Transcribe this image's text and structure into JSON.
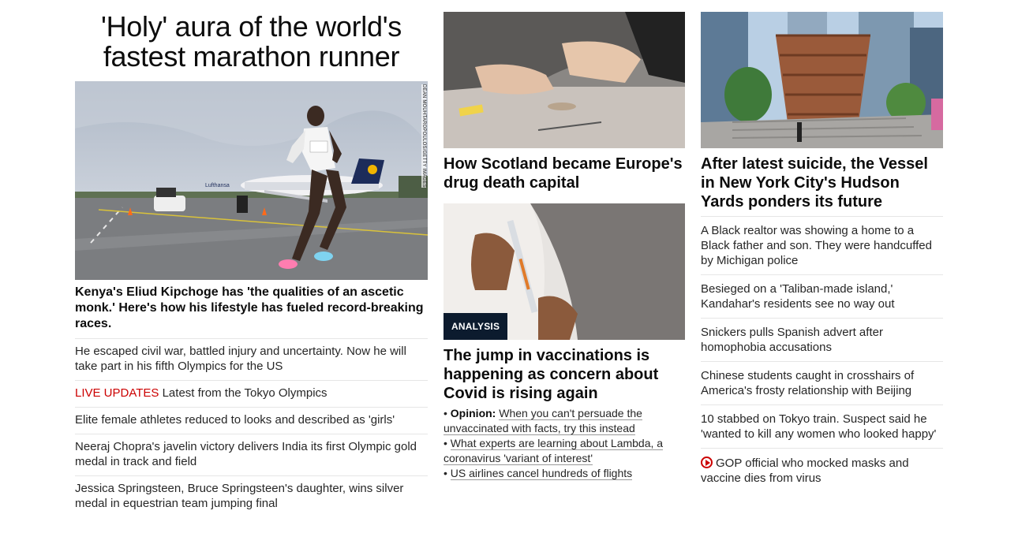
{
  "col1": {
    "title": "'Holy' aura of the world's fastest marathon runner",
    "image_credit": "DEAN MOUHTAROPOULOS/GETTY IMAGES",
    "caption": "Kenya's Eliud Kipchoge has 'the qualities of an ascetic monk.' Here's how his lifestyle has fueled record-breaking races.",
    "items": [
      {
        "text": "He escaped civil war, battled injury and uncertainty. Now he will take part in his fifth Olympics for the US"
      },
      {
        "live": "LIVE UPDATES",
        "text": " Latest from the Tokyo Olympics"
      },
      {
        "text": "Elite female athletes reduced to looks and described as 'girls'"
      },
      {
        "text": "Neeraj Chopra's javelin victory delivers India its first Olympic gold medal in track and field"
      },
      {
        "text": "Jessica Springsteen, Bruce Springsteen's daughter, wins silver medal in equestrian team jumping final"
      }
    ]
  },
  "col2": {
    "story1": {
      "headline": "How Scotland became Europe's drug death capital"
    },
    "story2": {
      "badge": "ANALYSIS",
      "headline": "The jump in vaccinations is happening as concern about Covid is rising again",
      "bullets": [
        {
          "prefix": "Opinion:",
          "text": "When you can't persuade the unvaccinated with facts, try this instead"
        },
        {
          "text": "What experts are learning about Lambda, a coronavirus 'variant of interest'"
        },
        {
          "text": "US airlines cancel hundreds of flights"
        }
      ]
    }
  },
  "col3": {
    "headline": "After latest suicide, the Vessel in New York City's Hudson Yards ponders its future",
    "items": [
      {
        "text": "A Black realtor was showing a home to a Black father and son. They were handcuffed by Michigan police"
      },
      {
        "text": "Besieged on a 'Taliban-made island,' Kandahar's residents see no way out"
      },
      {
        "text": "Snickers pulls Spanish advert after homophobia accusations"
      },
      {
        "text": "Chinese students caught in crosshairs of America's frosty relationship with Beijing"
      },
      {
        "text": "10 stabbed on Tokyo train. Suspect said he 'wanted to kill any women who looked happy'"
      },
      {
        "icon": "play-video-icon",
        "text": "GOP official who mocked masks and vaccine dies from virus"
      }
    ]
  },
  "colors": {
    "live": "#cc0000",
    "badge_bg": "#0c1b2e",
    "divider": "#e6e6e6"
  }
}
